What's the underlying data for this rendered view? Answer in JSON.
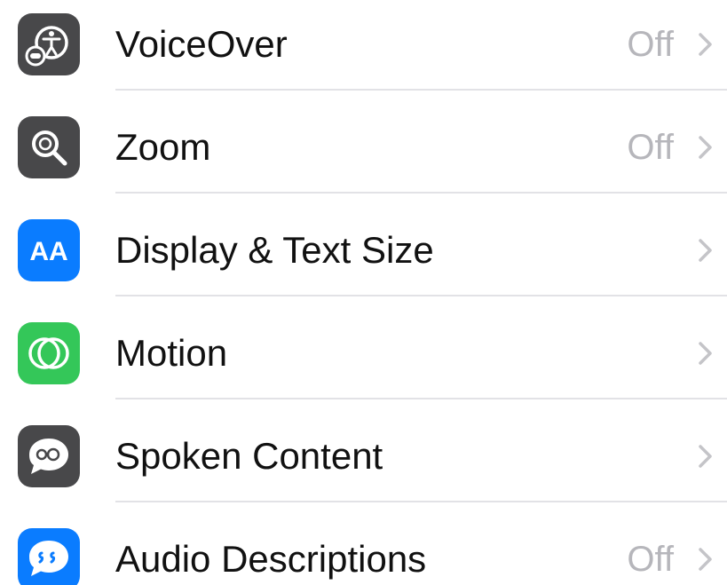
{
  "colors": {
    "dark_gray_icon": "#48484a",
    "blue_icon": "#0a7cff",
    "green_icon": "#34c759",
    "value_text": "#b6b6bb",
    "chevron": "#c4c4c8"
  },
  "rows": [
    {
      "label": "VoiceOver",
      "value": "Off",
      "icon": "voiceover-icon"
    },
    {
      "label": "Zoom",
      "value": "Off",
      "icon": "zoom-icon"
    },
    {
      "label": "Display & Text Size",
      "value": "",
      "icon": "display-text-size-icon"
    },
    {
      "label": "Motion",
      "value": "",
      "icon": "motion-icon"
    },
    {
      "label": "Spoken Content",
      "value": "",
      "icon": "spoken-content-icon"
    },
    {
      "label": "Audio Descriptions",
      "value": "Off",
      "icon": "audio-descriptions-icon"
    }
  ],
  "icon_text": {
    "display_text_size": "AA"
  }
}
